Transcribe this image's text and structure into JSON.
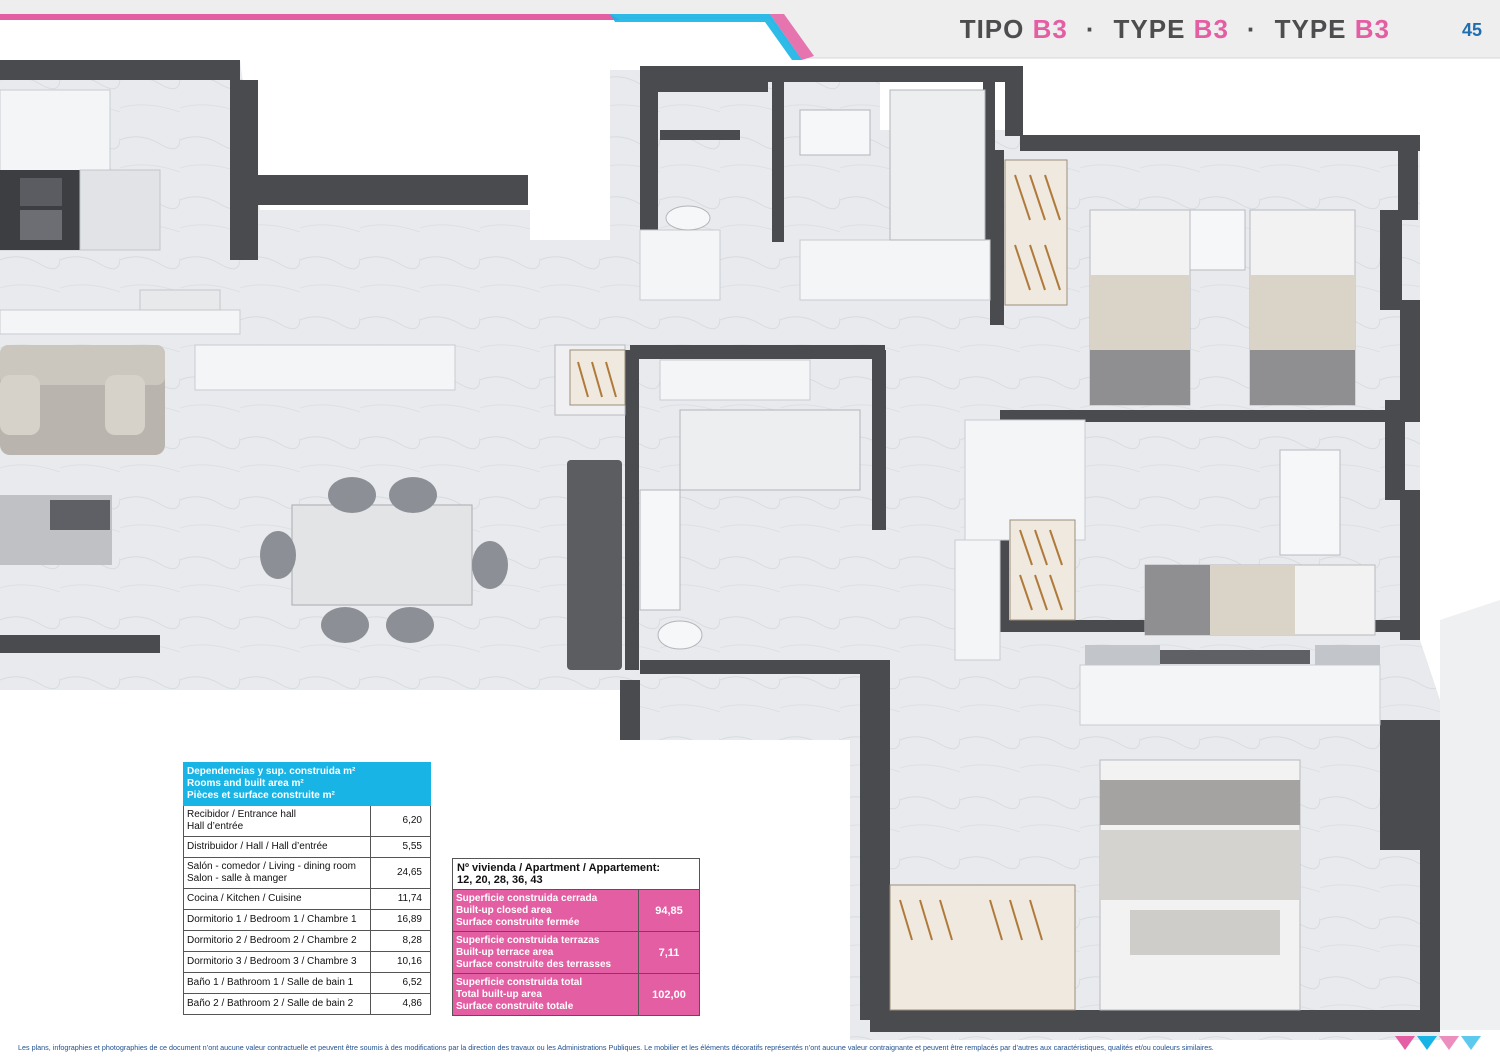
{
  "header": {
    "t1_word": "TIPO",
    "t1_code": "B3",
    "t2_word": "TYPE",
    "t2_code": "B3",
    "t3_word": "TYPE",
    "t3_code": "B3",
    "separator": "·",
    "page_number": "45"
  },
  "areas": {
    "title_es": "Dependencias y sup. construida m²",
    "title_en": "Rooms and built area m²",
    "title_fr": "Pièces et surface construite m²",
    "rows": [
      {
        "l1": "Recibidor / Entrance hall",
        "l2": "Hall d’entrée",
        "value": "6,20"
      },
      {
        "l1": "Distribuidor / Hall / Hall d’entrée",
        "l2": "",
        "value": "5,55"
      },
      {
        "l1": "Salón - comedor / Living - dining room",
        "l2": "Salon - salle à manger",
        "value": "24,65"
      },
      {
        "l1": "Cocina / Kitchen / Cuisine",
        "l2": "",
        "value": "11,74"
      },
      {
        "l1": "Dormitorio 1 / Bedroom 1 / Chambre 1",
        "l2": "",
        "value": "16,89"
      },
      {
        "l1": "Dormitorio 2 / Bedroom 2 / Chambre 2",
        "l2": "",
        "value": "8,28"
      },
      {
        "l1": "Dormitorio 3 / Bedroom 3 / Chambre 3",
        "l2": "",
        "value": "10,16"
      },
      {
        "l1": "Baño 1 / Bathroom 1 / Salle de bain 1",
        "l2": "",
        "value": "6,52"
      },
      {
        "l1": "Baño 2 / Bathroom 2 / Salle de bain 2",
        "l2": "",
        "value": "4,86"
      }
    ]
  },
  "surfaces": {
    "apartment_label": "Nº vivienda / Apartment / Appartement:",
    "apartment_numbers": "12, 20, 28, 36, 43",
    "rows": [
      {
        "es": "Superficie construida cerrada",
        "en": "Built-up closed area",
        "fr": "Surface construite fermée",
        "value": "94,85"
      },
      {
        "es": "Superficie construida terrazas",
        "en": "Built-up terrace area",
        "fr": "Surface construite des terrasses",
        "value": "7,11"
      },
      {
        "es": "Superficie construida total",
        "en": "Total built-up area",
        "fr": "Surface construite totale",
        "value": "102,00"
      }
    ]
  },
  "footer": {
    "disclaimer": "Les plans, infographies et photographies de ce document n’ont aucune valeur contractuelle et peuvent être soumis à des modifications par la direction des travaux ou les Administrations Publiques. Le mobilier et les éléments décoratifs représentés n’ont aucune valeur contraignante et peuvent être remplacés par d’autres aux caractéristiques, qualités et/ou couleurs similaires."
  },
  "colors": {
    "accent_pink": "#e45ea3",
    "accent_blue": "#18b4e6",
    "wall": "#4a4b4f",
    "floor": "#e9ebed"
  }
}
